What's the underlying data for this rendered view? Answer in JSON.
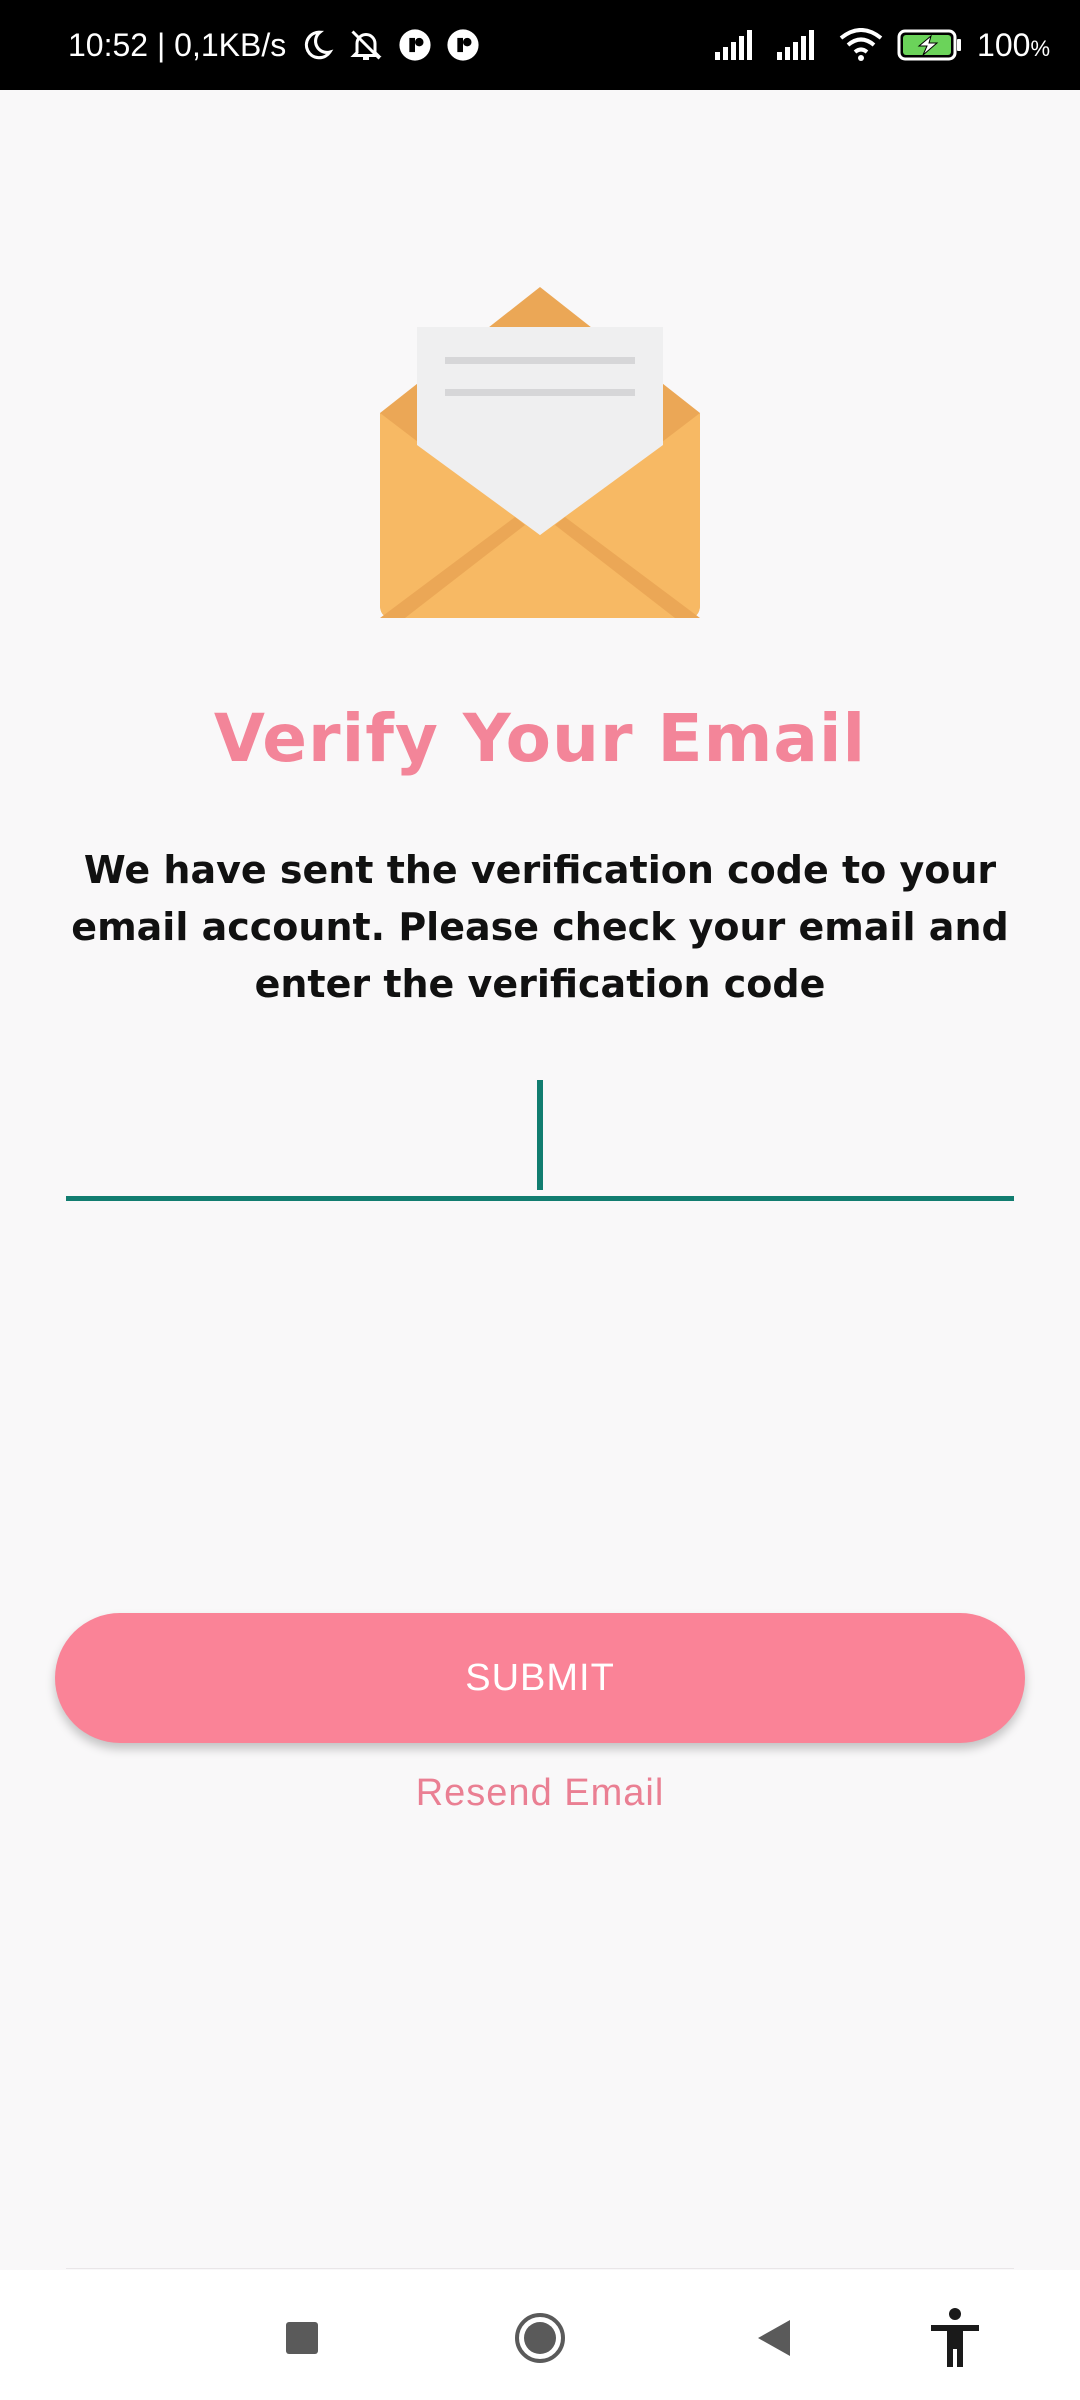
{
  "status_bar": {
    "time_speed": "10:52 | 0,1KB/s",
    "battery": "100",
    "battery_unit": "%",
    "icons": [
      "moon-icon",
      "bell-off-icon",
      "app-icon",
      "app-icon",
      "signal-icon",
      "signal-icon",
      "wifi-icon",
      "battery-charging-icon"
    ]
  },
  "page": {
    "title": "Verify Your Email",
    "description": "We have sent the verification code to your email account. Please check your email and enter the verification code",
    "code_value": "",
    "submit_label": "SUBMIT",
    "resend_label": "Resend Email"
  },
  "nav_bar": {
    "buttons": [
      "recent-apps-icon",
      "home-icon",
      "back-icon",
      "accessibility-icon"
    ]
  },
  "colors": {
    "title": "#f38599",
    "button": "#fa8397",
    "input_line": "#127d70",
    "envelope": "#f7b964",
    "envelope_dark": "#eba756"
  }
}
